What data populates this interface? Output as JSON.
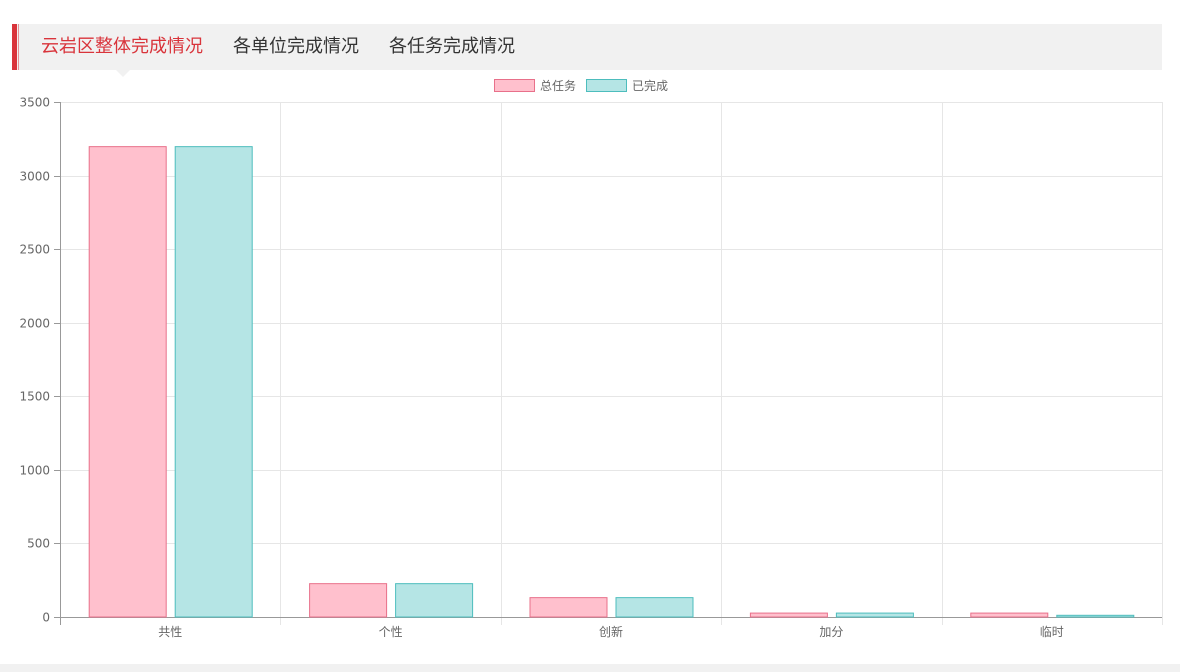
{
  "tabs": [
    {
      "label": "云岩区整体完成情况",
      "active": true
    },
    {
      "label": "各单位完成情况",
      "active": false
    },
    {
      "label": "各任务完成情况",
      "active": false
    }
  ],
  "colors": {
    "accent": "#d9343b",
    "series_total_fill": "#ffc0cd",
    "series_total_stroke": "#e8708a",
    "series_done_fill": "#b5e5e5",
    "series_done_stroke": "#4dbdbd"
  },
  "chart_data": {
    "type": "bar",
    "categories": [
      "共性",
      "个性",
      "创新",
      "加分",
      "临时"
    ],
    "series": [
      {
        "name": "总任务",
        "values": [
          3200,
          230,
          135,
          30,
          30
        ]
      },
      {
        "name": "已完成",
        "values": [
          3200,
          230,
          135,
          30,
          15
        ]
      }
    ],
    "ylim": [
      0,
      3500
    ],
    "yticks": [
      "0",
      "500",
      "1000",
      "1500",
      "2000",
      "2500",
      "3000",
      "3500"
    ],
    "grid": true,
    "legend": "top-center"
  }
}
